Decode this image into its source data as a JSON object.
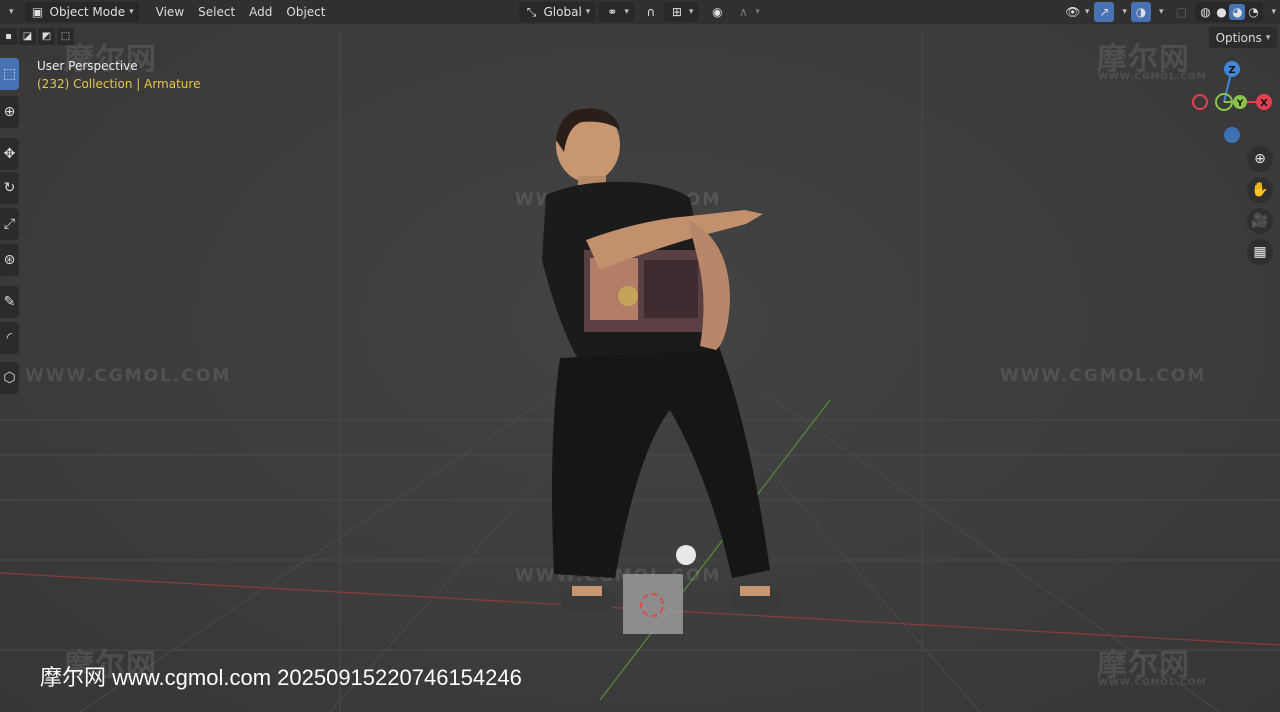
{
  "header": {
    "mode": "Object Mode",
    "menus": [
      "View",
      "Select",
      "Add",
      "Object"
    ],
    "transform_orientation": "Global"
  },
  "viewport": {
    "view_name": "User Perspective",
    "collection_label": "(232) Collection | Armature",
    "options_label": "Options"
  },
  "gizmo": {
    "x": "X",
    "y": "Y",
    "z": "Z"
  },
  "watermarks": {
    "logo": "摩尔网",
    "url": "WWW.CGMOL.COM",
    "bottom": "摩尔网 www.cgmol.com 20250915220746154246"
  },
  "colors": {
    "header_bg": "#303030",
    "accent": "#4772b3",
    "x_axis": "#e2404f",
    "y_axis": "#8bc34a",
    "z_axis": "#3f87d9",
    "collection_text": "#e6c845"
  },
  "icons": [
    "object-mode-icon",
    "transform-icon",
    "link-icon",
    "snap-magnet-icon",
    "snap-grid-icon",
    "proportional-icon",
    "falloff-icon",
    "visibility-icon",
    "gizmo-icon",
    "overlay-icon",
    "xray-icon",
    "wireframe-icon",
    "solid-icon",
    "material-icon",
    "rendered-icon",
    "zoom-icon",
    "hand-pan-icon",
    "camera-icon",
    "grid-view-icon"
  ]
}
